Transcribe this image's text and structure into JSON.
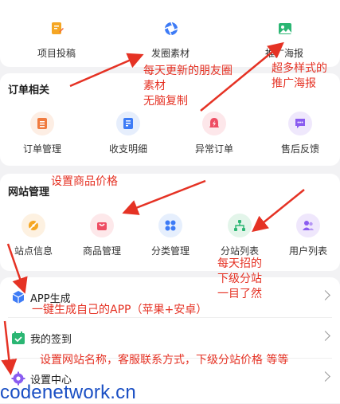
{
  "top_tools": [
    {
      "label": "项目投稿",
      "icon": "edit-doc-icon"
    },
    {
      "label": "发圈素材",
      "icon": "aperture-icon"
    },
    {
      "label": "推广海报",
      "icon": "image-icon"
    }
  ],
  "orders": {
    "title": "订单相关",
    "items": [
      {
        "label": "订单管理",
        "icon": "order-list-icon"
      },
      {
        "label": "收支明细",
        "icon": "ledger-icon"
      },
      {
        "label": "异常订单",
        "icon": "alert-icon"
      },
      {
        "label": "售后反馈",
        "icon": "chat-bubble-icon"
      }
    ]
  },
  "site": {
    "title": "网站管理",
    "items": [
      {
        "label": "站点信息",
        "icon": "site-info-icon"
      },
      {
        "label": "商品管理",
        "icon": "shopping-bag-icon"
      },
      {
        "label": "分类管理",
        "icon": "category-grid-icon"
      },
      {
        "label": "分站列表",
        "icon": "org-tree-icon"
      },
      {
        "label": "用户列表",
        "icon": "users-icon"
      }
    ]
  },
  "menu": [
    {
      "label": "APP生成",
      "icon": "cube-icon"
    },
    {
      "label": "我的签到",
      "icon": "calendar-check-icon"
    },
    {
      "label": "设置中心",
      "icon": "gear-icon"
    }
  ],
  "annotations": {
    "moments": [
      "每天更新的朋友圈",
      "素材",
      "无脑复制"
    ],
    "poster": [
      "超多样式的",
      "推广海报"
    ],
    "price": "设置商品价格",
    "substation": [
      "每天招的",
      "下级分站",
      "一目了然"
    ],
    "app": "一键生成自己的APP（苹果+安卓）",
    "settings": "设置网站名称，客服联系方式，下级分站价格 等等"
  },
  "watermark": "codenetwork.cn",
  "colors": {
    "annotation": "#e53224",
    "watermark": "#1a4fc4"
  }
}
